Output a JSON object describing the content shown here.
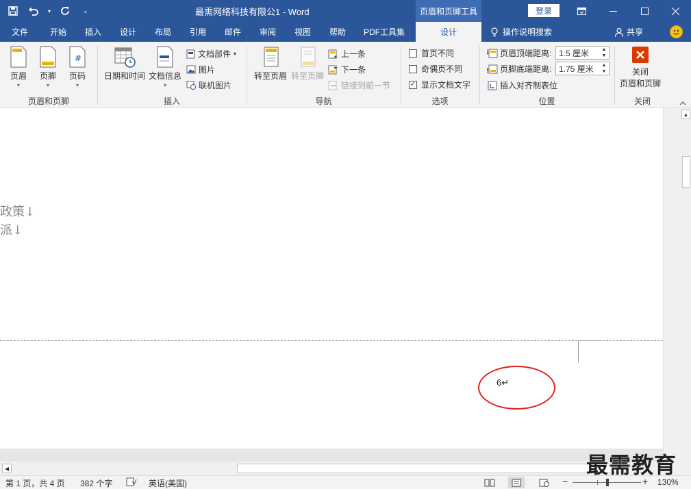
{
  "window": {
    "doc_title": "最需网络科技有限公1  -  Word",
    "context_tab_title": "页眉和页脚工具",
    "login_label": "登录"
  },
  "tabs": [
    {
      "label": "文件"
    },
    {
      "label": "开始"
    },
    {
      "label": "插入"
    },
    {
      "label": "设计"
    },
    {
      "label": "布局"
    },
    {
      "label": "引用"
    },
    {
      "label": "邮件"
    },
    {
      "label": "审阅"
    },
    {
      "label": "视图"
    },
    {
      "label": "帮助"
    },
    {
      "label": "PDF工具集"
    },
    {
      "label": "设计",
      "active": true
    }
  ],
  "tell_me": "操作说明搜索",
  "share": "共享",
  "ribbon": {
    "groups": {
      "header_footer": {
        "label": "页眉和页脚",
        "header": "页眉",
        "footer": "页脚",
        "page_number": "页码"
      },
      "insert": {
        "label": "插入",
        "date_time": "日期和时间",
        "doc_info": "文档信息",
        "quick_parts": "文档部件",
        "picture": "图片",
        "online_picture": "联机图片"
      },
      "navigation": {
        "label": "导航",
        "goto_header": "转至页眉",
        "goto_footer": "转至页脚",
        "previous": "上一条",
        "next": "下一条",
        "link_previous": "链接到前一节"
      },
      "options": {
        "label": "选项",
        "different_first": "首页不同",
        "different_odd_even": "奇偶页不同",
        "show_doc_text": "显示文档文字",
        "show_doc_text_checked": true
      },
      "position": {
        "label": "位置",
        "header_top_label": "页眉顶端距离:",
        "header_top_value": "1.5 厘米",
        "footer_bottom_label": "页脚底端距离:",
        "footer_bottom_value": "1.75 厘米",
        "insert_align_tab": "插入对齐制表位"
      },
      "close": {
        "label": "关闭",
        "close_line1": "关闭",
        "close_line2": "页眉和页脚"
      }
    }
  },
  "document": {
    "line1": "政策↓",
    "line2": "派↓",
    "footer_page_number": "6↵"
  },
  "statusbar": {
    "page": "第 1 页，共 4 页",
    "words": "382 个字",
    "language": "英语(美国)",
    "zoom": "130%"
  },
  "watermark": "最需教育",
  "colors": {
    "accent": "#2b579a",
    "annotation": "#e02020"
  }
}
